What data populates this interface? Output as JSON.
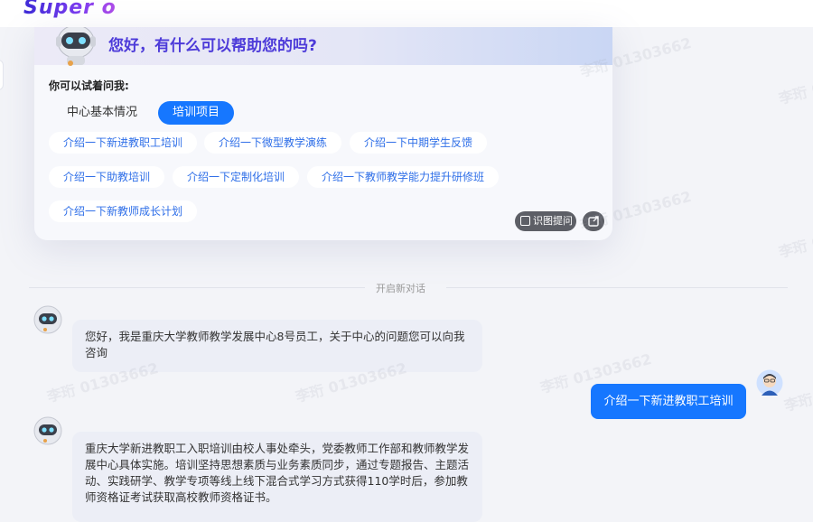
{
  "app": {
    "logo_text": "Super o"
  },
  "welcome": {
    "greeting": "您好，有什么可以帮助您的吗?",
    "try_label": "你可以试着问我:",
    "tabs": [
      {
        "label": "中心基本情况",
        "active": false
      },
      {
        "label": "培训项目",
        "active": true
      }
    ],
    "suggestions": [
      "介绍一下新进教职工培训",
      "介绍一下微型教学演练",
      "介绍一下中期学生反馈",
      "介绍一下助教培训",
      "介绍一下定制化培训",
      "介绍一下教师教学能力提升研修班",
      "介绍一下新教师成长计划"
    ],
    "image_question_label": "识图提问"
  },
  "chat": {
    "new_conversation_label": "开启新对话",
    "messages": [
      {
        "role": "assistant",
        "text": "您好，我是重庆大学教师教学发展中心8号员工，关于中心的问题您可以向我咨询"
      },
      {
        "role": "user",
        "text": "介绍一下新进教职工培训"
      },
      {
        "role": "assistant",
        "text": "重庆大学新进教职工入职培训由校人事处牵头，党委教师工作部和教师教学发展中心具体实施。培训坚持思想素质与业务素质同步，通过专题报告、主题活动、实践研学、教学专项等线上线下混合式学习方式获得110学时后，参加教师资格证考试获取高校教师资格证书。"
      }
    ]
  },
  "watermark": {
    "text": "李珩 01303662"
  },
  "colors": {
    "accent": "#1677ff",
    "greeting": "#4d3bd9",
    "chip_text": "#2f6fe8"
  },
  "icons": {
    "bot_avatar": "robot-avatar-icon",
    "user_avatar": "user-avatar-icon",
    "image_question": "scan-image-icon",
    "share": "share-export-icon"
  }
}
